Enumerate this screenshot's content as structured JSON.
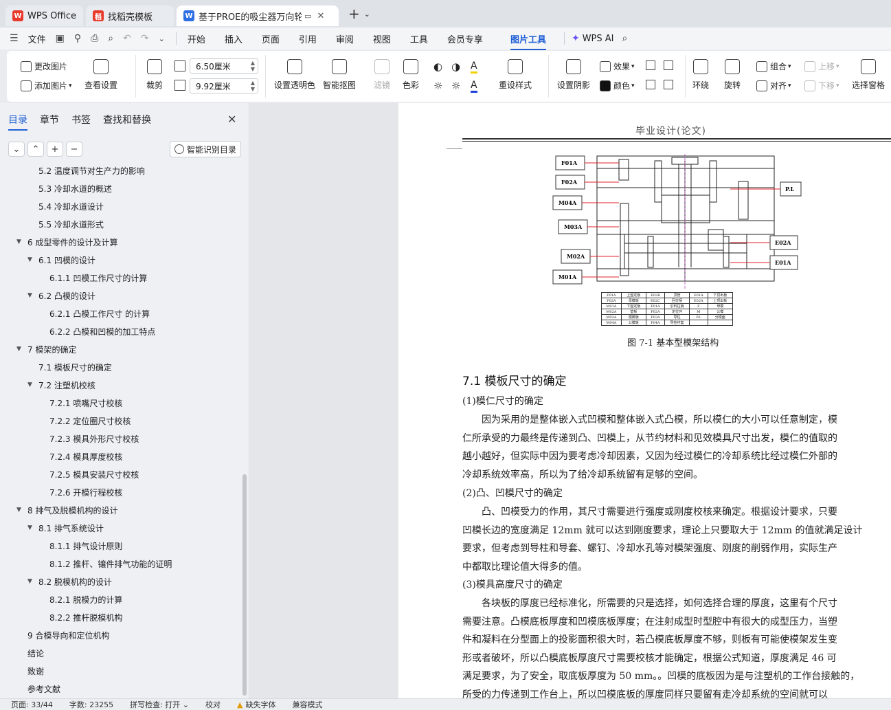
{
  "tabs": [
    {
      "label": "WPS Office",
      "logo_color": "#e8392d",
      "logo": "W"
    },
    {
      "label": "找稻壳模板",
      "logo_color": "#e8392d",
      "logo": "稻"
    },
    {
      "label": "基于PROE的吸尘器万向轮注",
      "logo_color": "#2f6fe4",
      "logo": "W"
    }
  ],
  "menu": {
    "file": "文件",
    "items": [
      "开始",
      "插入",
      "页面",
      "引用",
      "审阅",
      "视图",
      "工具",
      "会员专享"
    ],
    "active": "图片工具",
    "ai": "WPS AI"
  },
  "ribbon": {
    "change_image": "更改图片",
    "add_image": "添加图片",
    "view_settings": "查看设置",
    "crop": "裁剪",
    "width": "6.50厘米",
    "height": "9.92厘米",
    "set_transparent": "设置透明色",
    "smart_cutout": "智能抠图",
    "filter": "滤镜",
    "color": "色彩",
    "reset_style": "重设样式",
    "set_shadow": "设置阴影",
    "effect": "效果",
    "fill_color": "颜色",
    "wrap": "环绕",
    "rotate": "旋转",
    "group": "组合",
    "align": "对齐",
    "move_up": "上移",
    "move_down": "下移",
    "select_pane": "选择窗格"
  },
  "nav": {
    "tabs": [
      "目录",
      "章节",
      "书签",
      "查找和替换"
    ],
    "smart_toc": "智能识别目录",
    "toc": [
      {
        "level": 2,
        "label": "5.2 温度调节对生产力的影响",
        "expand": false
      },
      {
        "level": 2,
        "label": "5.3 冷却水道的概述",
        "expand": false
      },
      {
        "level": 2,
        "label": "5.4 冷却水道设计",
        "expand": false
      },
      {
        "level": 2,
        "label": "5.5 冷却水道形式",
        "expand": false
      },
      {
        "level": 1,
        "label": "6 成型零件的设计及计算",
        "expand": true
      },
      {
        "level": 2,
        "label": "6.1 凹模的设计",
        "expand": true
      },
      {
        "level": 3,
        "label": "6.1.1 凹模工作尺寸的计算",
        "expand": false
      },
      {
        "level": 2,
        "label": "6.2 凸模的设计",
        "expand": true
      },
      {
        "level": 3,
        "label": "6.2.1 凸模工作尺寸 的计算",
        "expand": false
      },
      {
        "level": 3,
        "label": "6.2.2 凸模和凹模的加工特点",
        "expand": false
      },
      {
        "level": 1,
        "label": "7 模架的确定",
        "expand": true
      },
      {
        "level": 2,
        "label": "7.1 模板尺寸的确定",
        "expand": false
      },
      {
        "level": 2,
        "label": "7.2 注塑机校核",
        "expand": true
      },
      {
        "level": 3,
        "label": "7.2.1 喷嘴尺寸校核",
        "expand": false
      },
      {
        "level": 3,
        "label": "7.2.2 定位圈尺寸校核",
        "expand": false
      },
      {
        "level": 3,
        "label": "7.2.3 模具外形尺寸校核",
        "expand": false
      },
      {
        "level": 3,
        "label": "7.2.4 模具厚度校核",
        "expand": false
      },
      {
        "level": 3,
        "label": "7.2.5 模具安装尺寸校核",
        "expand": false
      },
      {
        "level": 3,
        "label": "7.2.6 开模行程校核",
        "expand": false
      },
      {
        "level": 1,
        "label": "8 排气及脱模机构的设计",
        "expand": true
      },
      {
        "level": 2,
        "label": "8.1 排气系统设计",
        "expand": true
      },
      {
        "level": 3,
        "label": "8.1.1 排气设计原则",
        "expand": false
      },
      {
        "level": 3,
        "label": "8.1.2 推杆、镶件排气功能的证明",
        "expand": false
      },
      {
        "level": 2,
        "label": "8.2 脱模机构的设计",
        "expand": true
      },
      {
        "level": 3,
        "label": "8.2.1 脱模力的计算",
        "expand": false
      },
      {
        "level": 3,
        "label": "8.2.2 推杆脱模机构",
        "expand": false
      },
      {
        "level": 1,
        "label": "9 合模导向和定位机构",
        "expand": false
      },
      {
        "level": 1,
        "label": "结论",
        "expand": false
      },
      {
        "level": 1,
        "label": "致谢",
        "expand": false
      },
      {
        "level": 1,
        "label": "参考文献",
        "expand": false
      }
    ]
  },
  "doc": {
    "header": "毕业设计(论文)",
    "figure_labels_left": [
      "F01A",
      "F02A",
      "M04A",
      "M03A",
      "M02A",
      "M01A"
    ],
    "figure_labels_right": [
      "P.L",
      "E02A",
      "E01A"
    ],
    "figure_table": [
      [
        "F01A",
        "上固定板",
        "E02B",
        "顶管",
        "E01A",
        "下顶出板"
      ],
      [
        "F02A",
        "母模板",
        "E02C",
        "回位柄",
        "E02A",
        "上顶出板"
      ],
      [
        "M01A",
        "下固定板",
        "F01A",
        "引料拉销",
        "F",
        "母模"
      ],
      [
        "M02A",
        "垫板",
        "F02A",
        "定位环",
        "M",
        "公模"
      ],
      [
        "M03A",
        "模脚板",
        "F03A",
        "导柱",
        "P.L",
        "分模面"
      ],
      [
        "M04A",
        "公模板",
        "F04A",
        "导柱衬套",
        "",
        ""
      ]
    ],
    "caption": "图 7-1 基本型模架结构",
    "section_title": "7.1 模板尺寸的确定",
    "sub1": "(1)模仁尺寸的确定",
    "para1": [
      "　　因为采用的是整体嵌入式凹模和整体嵌入式凸模，所以模仁的大小可以任意制定，模",
      "仁所承受的力最终是传递到凸、凹模上，从节约材料和见效模具尺寸出发，模仁的值取的",
      "越小越好，但实际中因为要考虑冷却因素，又因为经过模仁的冷却系统比经过模仁外部的",
      "冷却系统效率高，所以为了给冷却系统留有足够的空间。"
    ],
    "sub2": "(2)凸、凹模尺寸的确定",
    "para2": [
      "　　凸、凹模受力的作用，其尺寸需要进行强度或刚度校核来确定。根据设计要求，只要",
      "凹模长边的宽度满足 12mm 就可以达到刚度要求，理论上只要取大于 12mm 的值就满足设计",
      "要求，但考虑到导柱和导套、螺钉、冷却水孔等对模架强度、刚度的削弱作用，实际生产",
      "中都取比理论值大得多的值。"
    ],
    "sub3": "(3)模具高度尺寸的确定",
    "para3": [
      "　　各块板的厚度已经标准化，所需要的只是选择，如何选择合理的厚度，这里有个尺寸",
      "需要注意。凸模底板厚度和凹模底板厚度；在注射成型时型腔中有很大的成型压力，当塑",
      "件和凝料在分型面上的投影面积很大时，若凸模底板厚度不够，则板有可能使模架发生变",
      "形或者破坏，所以凸模底板厚度尺寸需要校核才能确定，根据公式知道，厚度满足 46 可",
      "满足要求，为了安全，取底板厚度为 50 mm。。凹模的底板因为是与注塑机的工作台接触的，",
      "所受的力传递到工作台上，所以凹模底板的厚度同样只要留有走冷却系统的空间就可以"
    ]
  },
  "status": {
    "page": "页面: 33/44",
    "words": "字数: 23255",
    "spell": "拼写检查: 打开",
    "proof": "校对",
    "missing_font": "缺失字体",
    "compat": "兼容模式"
  }
}
